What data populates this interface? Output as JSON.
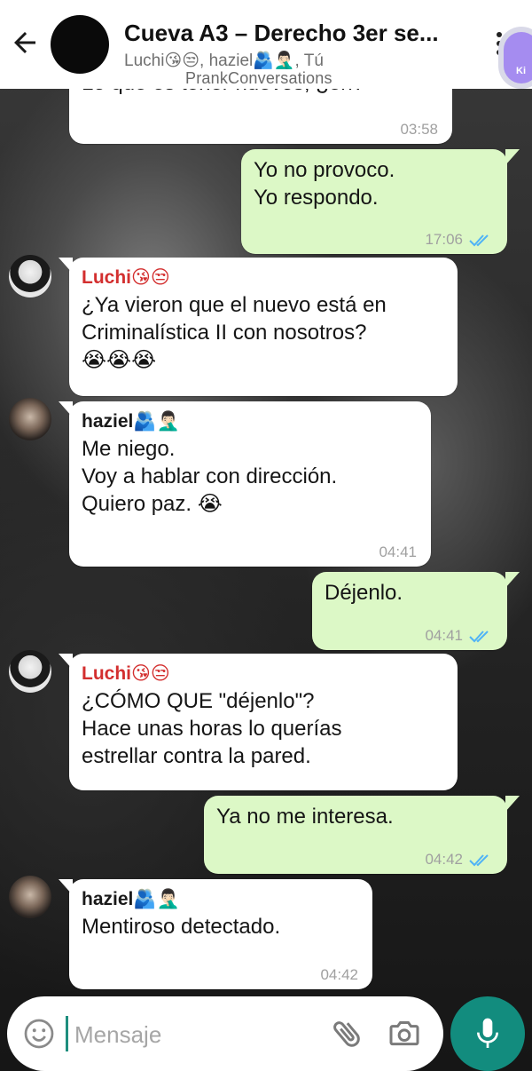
{
  "header": {
    "title": "Cueva A3 – Derecho 3er se...",
    "subtitle": "Luchi😘😒, haziel🫂🤦🏻‍♂️, Tú",
    "watermark": "PrankConversations",
    "badge_text": "Ki"
  },
  "messages": [
    {
      "direction": "in",
      "text": "Lo que es tener nuevos, ¿eh?",
      "time": "03:58"
    },
    {
      "direction": "out",
      "text": "Yo no provoco.\nYo respondo.",
      "time": "17:06",
      "status": "read"
    },
    {
      "direction": "in",
      "sender": "Luchi😘😒",
      "text": "¿Ya vieron que el nuevo está en\nCriminalística II con nosotros?\n😭😭😭",
      "time": ""
    },
    {
      "direction": "in",
      "sender": "haziel🫂🤦🏻‍♂️",
      "text": "Me niego.\nVoy a hablar con dirección.\nQuiero paz. 😭",
      "time": "04:41"
    },
    {
      "direction": "out",
      "text": "Déjenlo.",
      "time": "04:41",
      "status": "read"
    },
    {
      "direction": "in",
      "sender": "Luchi😘😒",
      "text": "¿CÓMO QUE \"déjenlo\"?\nHace unas horas lo querías\nestrellar contra la pared.",
      "time": ""
    },
    {
      "direction": "out",
      "text": "Ya no me interesa.",
      "time": "04:42",
      "status": "read"
    },
    {
      "direction": "in",
      "sender": "haziel🫂🤦🏻‍♂️",
      "text": "Mentiroso detectado.",
      "time": "04:42"
    }
  ],
  "input": {
    "placeholder": "Mensaje",
    "value": ""
  },
  "colors": {
    "outgoing_bubble": "#dcf8c6",
    "incoming_bubble": "#ffffff",
    "luchi_name": "#d32f2f",
    "haziel_name": "#1a1a1a",
    "read_ticks": "#4fb3f6",
    "mic_button": "#128c7e"
  },
  "icons": [
    "back-arrow-icon",
    "more-vert-icon",
    "emoji-icon",
    "attach-icon",
    "camera-icon",
    "mic-icon",
    "double-check-icon"
  ]
}
